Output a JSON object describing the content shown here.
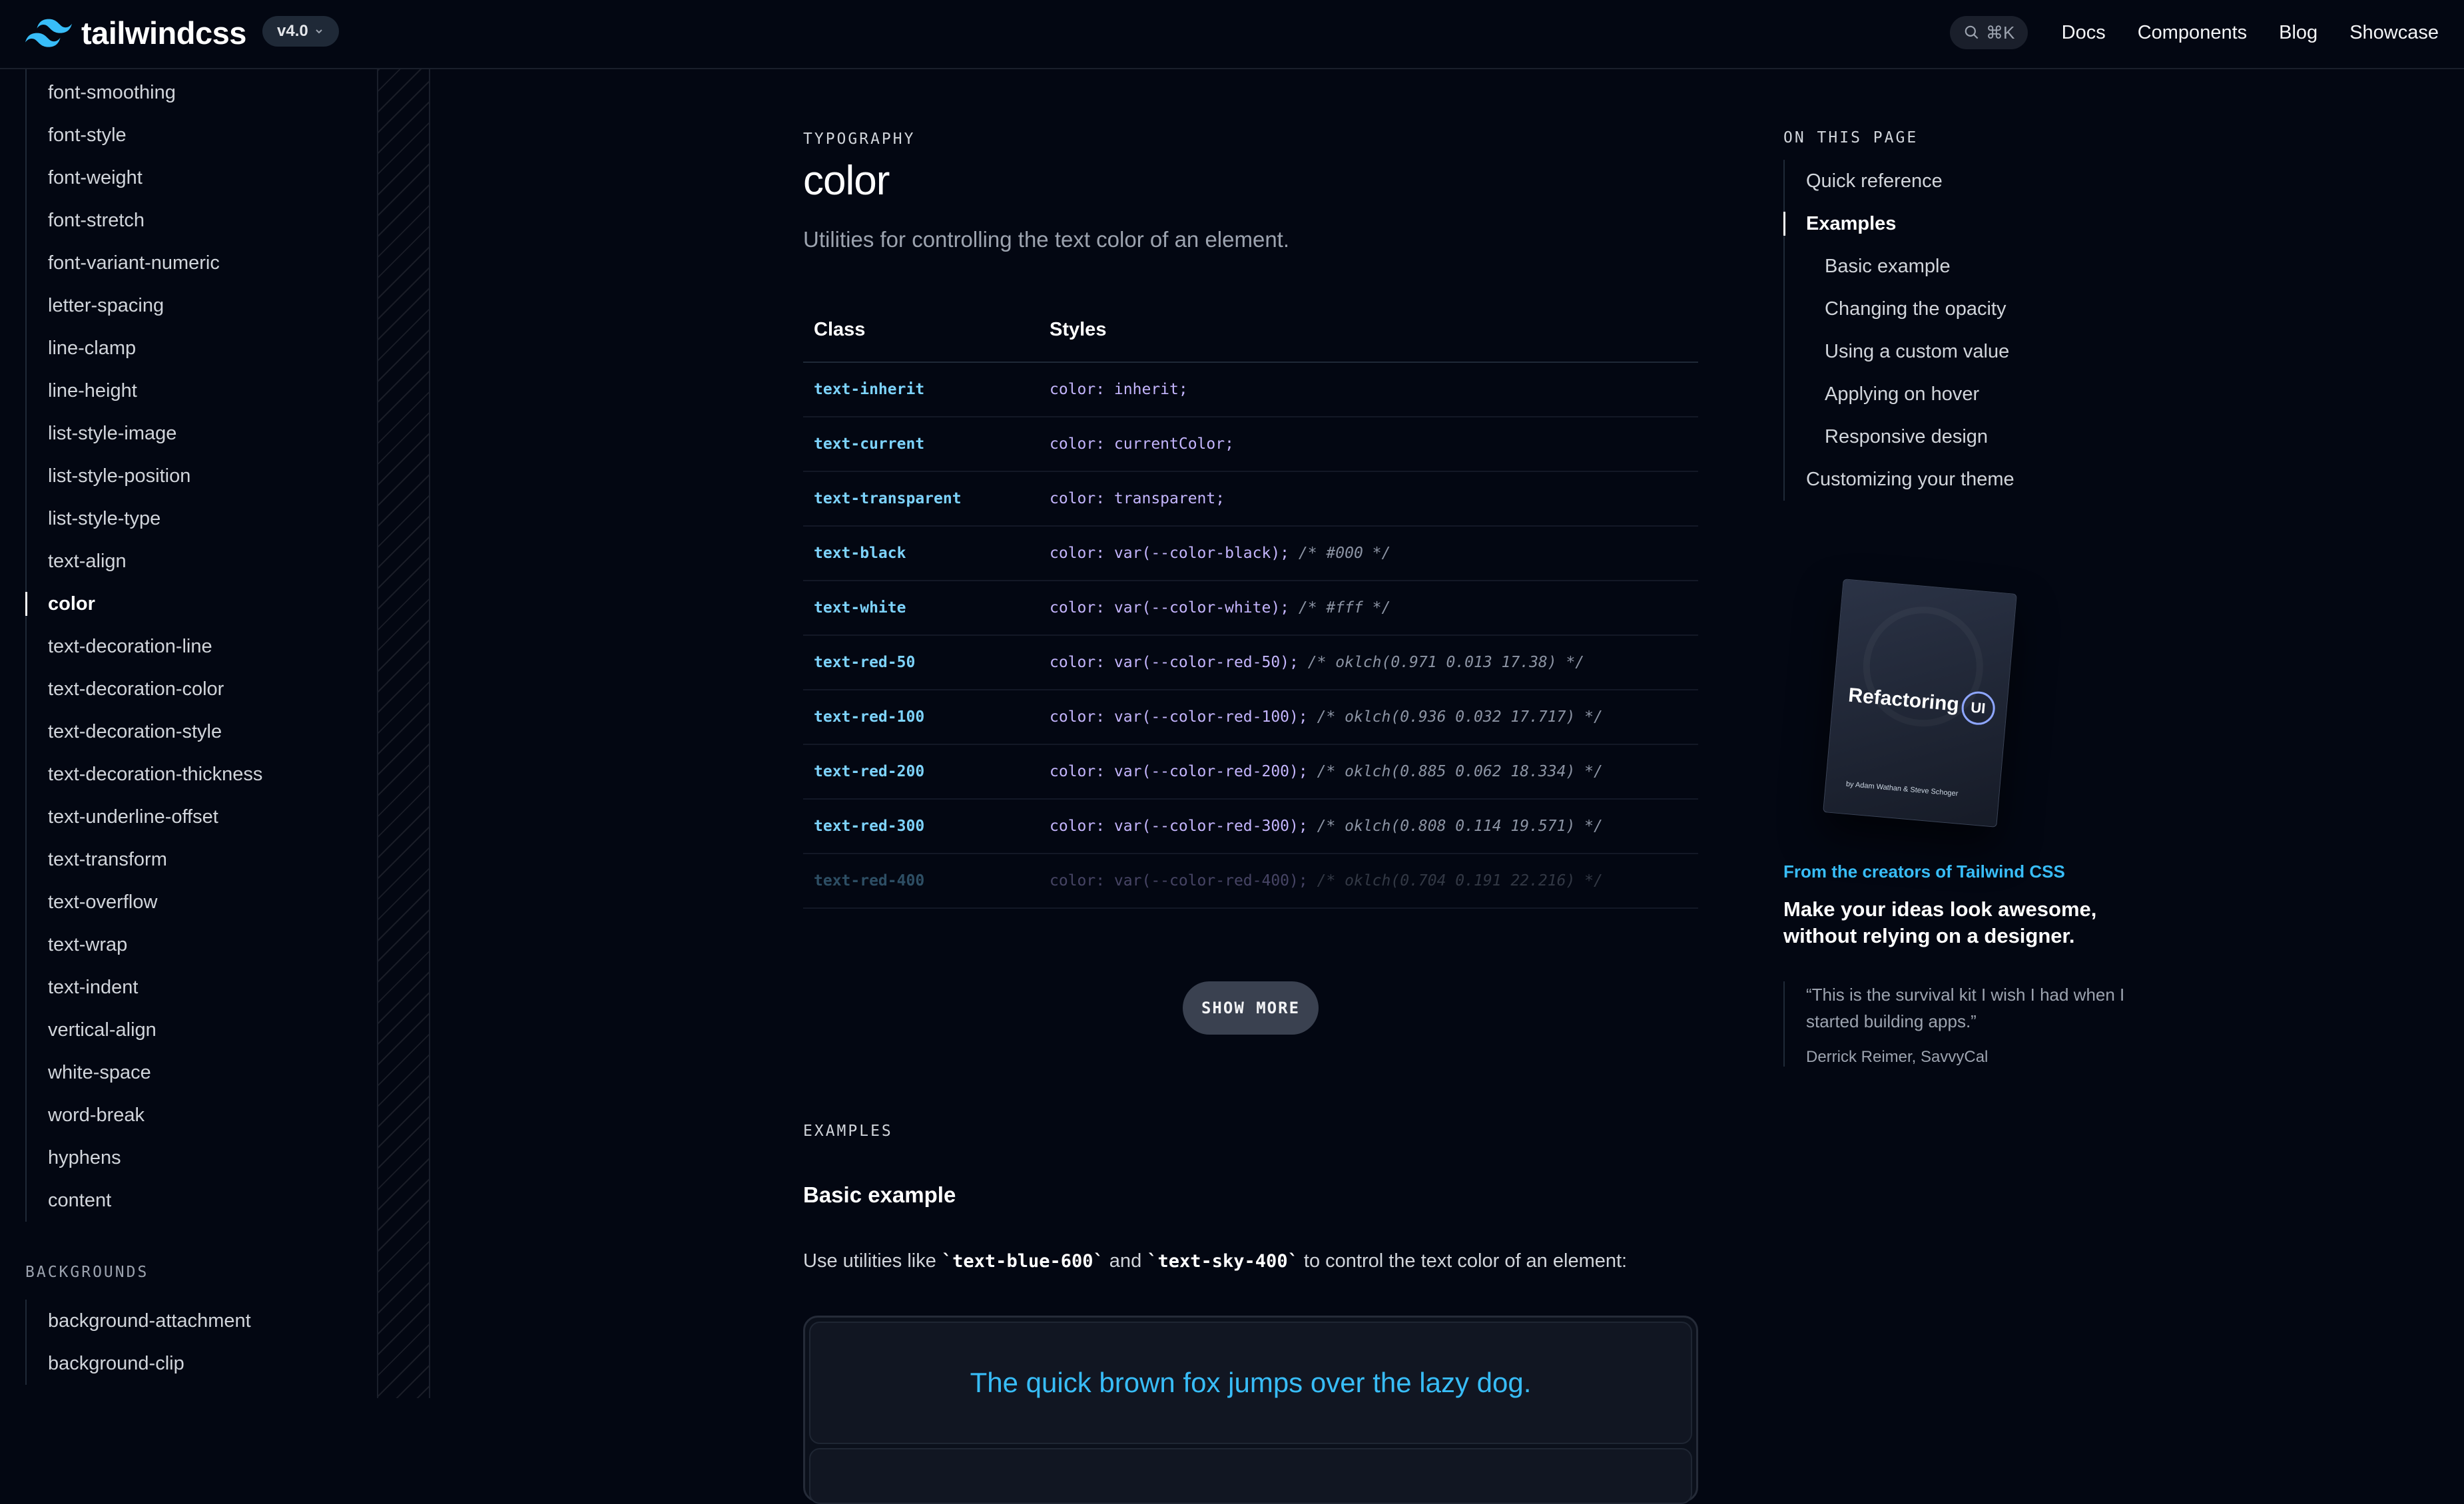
{
  "header": {
    "logo_text": "tailwindcss",
    "version": "v4.0",
    "search_shortcut": "⌘K",
    "nav": [
      "Docs",
      "Components",
      "Blog",
      "Showcase"
    ]
  },
  "sidebar": {
    "items": [
      {
        "label": "font-smoothing"
      },
      {
        "label": "font-style"
      },
      {
        "label": "font-weight"
      },
      {
        "label": "font-stretch"
      },
      {
        "label": "font-variant-numeric"
      },
      {
        "label": "letter-spacing"
      },
      {
        "label": "line-clamp"
      },
      {
        "label": "line-height"
      },
      {
        "label": "list-style-image"
      },
      {
        "label": "list-style-position"
      },
      {
        "label": "list-style-type"
      },
      {
        "label": "text-align"
      },
      {
        "label": "color"
      },
      {
        "label": "text-decoration-line"
      },
      {
        "label": "text-decoration-color"
      },
      {
        "label": "text-decoration-style"
      },
      {
        "label": "text-decoration-thickness"
      },
      {
        "label": "text-underline-offset"
      },
      {
        "label": "text-transform"
      },
      {
        "label": "text-overflow"
      },
      {
        "label": "text-wrap"
      },
      {
        "label": "text-indent"
      },
      {
        "label": "vertical-align"
      },
      {
        "label": "white-space"
      },
      {
        "label": "word-break"
      },
      {
        "label": "hyphens"
      },
      {
        "label": "content"
      }
    ],
    "active_item": "color",
    "section2_title": "BACKGROUNDS",
    "section2_items": [
      {
        "label": "background-attachment"
      },
      {
        "label": "background-clip"
      }
    ]
  },
  "main": {
    "eyebrow": "TYPOGRAPHY",
    "title": "color",
    "lead": "Utilities for controlling the text color of an element.",
    "table": {
      "headers": [
        "Class",
        "Styles"
      ],
      "rows": [
        {
          "cls": "text-inherit",
          "style": "color: inherit;",
          "comment": ""
        },
        {
          "cls": "text-current",
          "style": "color: currentColor;",
          "comment": ""
        },
        {
          "cls": "text-transparent",
          "style": "color: transparent;",
          "comment": ""
        },
        {
          "cls": "text-black",
          "style": "color: var(--color-black);",
          "comment": "/* #000 */"
        },
        {
          "cls": "text-white",
          "style": "color: var(--color-white);",
          "comment": "/* #fff */"
        },
        {
          "cls": "text-red-50",
          "style": "color: var(--color-red-50);",
          "comment": "/* oklch(0.971 0.013 17.38) */"
        },
        {
          "cls": "text-red-100",
          "style": "color: var(--color-red-100);",
          "comment": "/* oklch(0.936 0.032 17.717) */"
        },
        {
          "cls": "text-red-200",
          "style": "color: var(--color-red-200);",
          "comment": "/* oklch(0.885 0.062 18.334) */"
        },
        {
          "cls": "text-red-300",
          "style": "color: var(--color-red-300);",
          "comment": "/* oklch(0.808 0.114 19.571) */"
        },
        {
          "cls": "text-red-400",
          "style": "color: var(--color-red-400);",
          "comment": "/* oklch(0.704 0.191 22.216) */"
        }
      ]
    },
    "show_more": "SHOW MORE",
    "examples_eyebrow": "EXAMPLES",
    "basic_title": "Basic example",
    "basic_desc_pre": "Use utilities like ",
    "basic_code1": "`text-blue-600`",
    "basic_desc_mid": " and ",
    "basic_code2": "`text-sky-400`",
    "basic_desc_post": " to control the text color of an element:",
    "demo_text": "The quick brown fox jumps over the lazy dog."
  },
  "toc": {
    "title": "ON THIS PAGE",
    "items": [
      {
        "label": "Quick reference",
        "sub": false,
        "active": false
      },
      {
        "label": "Examples",
        "sub": false,
        "active": true
      },
      {
        "label": "Basic example",
        "sub": true,
        "active": false
      },
      {
        "label": "Changing the opacity",
        "sub": true,
        "active": false
      },
      {
        "label": "Using a custom value",
        "sub": true,
        "active": false
      },
      {
        "label": "Applying on hover",
        "sub": true,
        "active": false
      },
      {
        "label": "Responsive design",
        "sub": true,
        "active": false
      },
      {
        "label": "Customizing your theme",
        "sub": false,
        "active": false
      }
    ]
  },
  "ad": {
    "book_title": "Refactoring",
    "book_ring": "UI",
    "book_authors": "by Adam Wathan & Steve Schoger",
    "kicker": "From the creators of Tailwind CSS",
    "title": "Make your ideas look awesome, without relying on a designer.",
    "quote": "“This is the survival kit I wish I had when I started building apps.”",
    "quote_author": "Derrick Reimer, SavvyCal"
  },
  "colors": {
    "background": "#030712",
    "accent": "#38bdf8",
    "class_text": "#7dd3fc",
    "style_text": "#c4b5fd"
  }
}
